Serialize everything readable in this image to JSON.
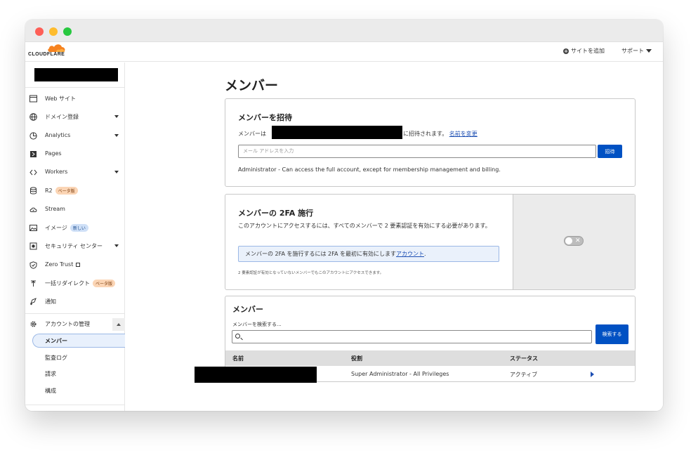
{
  "topbar": {
    "logo_text": "CLOUDFLARE",
    "add_site": "サイトを追加",
    "support": "サポート"
  },
  "colors": {
    "accent": "#0051c3",
    "logo_orange": "#f6821f",
    "info_bg": "#eaf1fb"
  },
  "sidebar": {
    "items": [
      {
        "label": "Web サイト",
        "icon": "browser-icon"
      },
      {
        "label": "ドメイン登録",
        "icon": "globe-icon",
        "expand": true
      },
      {
        "label": "Analytics",
        "icon": "chart-icon",
        "expand": true
      },
      {
        "label": "Pages",
        "icon": "pages-icon"
      },
      {
        "label": "Workers",
        "icon": "code-icon",
        "expand": true
      },
      {
        "label": "R2",
        "icon": "database-icon",
        "badge": "ベータ版"
      },
      {
        "label": "Stream",
        "icon": "cloud-icon"
      },
      {
        "label": "イメージ",
        "icon": "image-icon",
        "badge": "新しい"
      },
      {
        "label": "セキュリティ センター",
        "icon": "shield-icon",
        "expand": true
      },
      {
        "label": "Zero Trust",
        "icon": "zero-trust-icon"
      },
      {
        "label": "一括リダイレクト",
        "icon": "redirect-icon",
        "badge": "ベータ版"
      },
      {
        "label": "通知",
        "icon": "notification-icon"
      }
    ],
    "account_section": "アカウントの管理",
    "sub_items": [
      "メンバー",
      "監査ログ",
      "請求",
      "構成"
    ]
  },
  "main": {
    "title": "メンバー",
    "invite": {
      "heading": "メンバーを招待",
      "line_prefix": "メンバーは",
      "line_suffix": "に招待されます。",
      "rename_link": "名前を変更",
      "email_placeholder": "メール アドレスを入力",
      "invite_button": "招待",
      "role_desc": "Administrator - Can access the full account, except for membership management and billing."
    },
    "twofa": {
      "heading": "メンバーの 2FA 施行",
      "desc": "このアカウントにアクセスするには、すべてのメンバーで 2 要素認証を有効にする必要があります。",
      "info": "メンバーの 2FA を施行するには 2FA を最初に有効にします",
      "info_link": "アカウント",
      "note": "2 要素認証が有効となっていないメンバーでもこのアカウントにアクセスできます。",
      "toggle_on": false
    },
    "members": {
      "heading": "メンバー",
      "search_label": "メンバーを検索する...",
      "search_button": "検索する",
      "columns": [
        "名前",
        "役割",
        "ステータス"
      ],
      "rows": [
        {
          "role": "Super Administrator - All Privileges",
          "status": "アクティブ"
        }
      ]
    }
  }
}
